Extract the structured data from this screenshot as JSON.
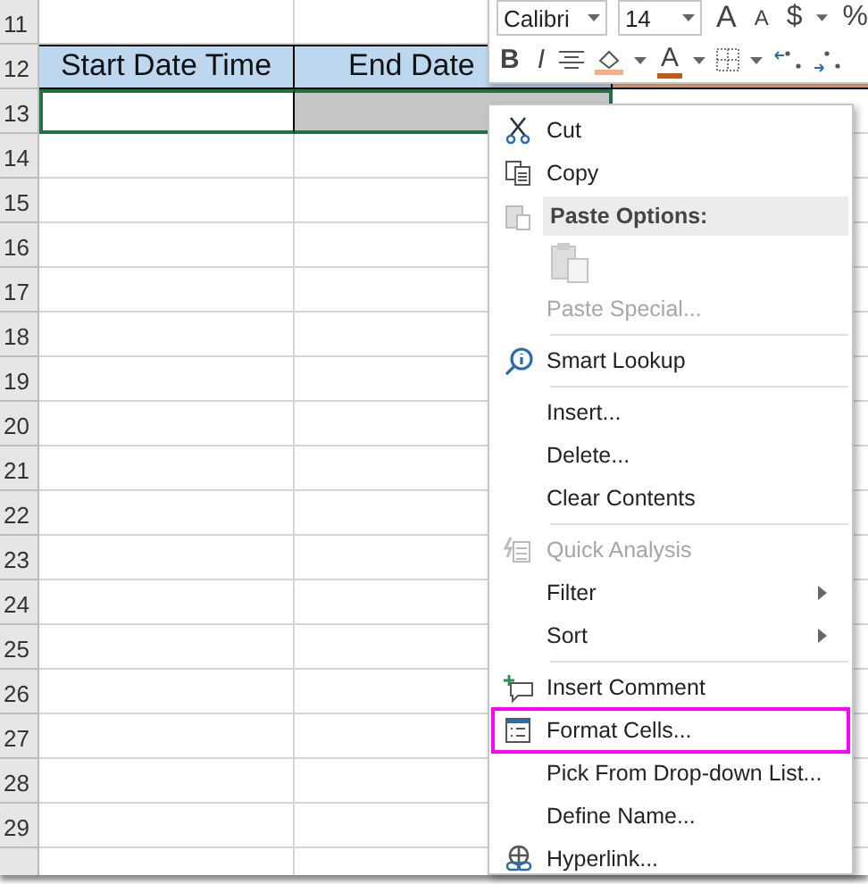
{
  "sheet": {
    "rows": [
      {
        "number": "11"
      },
      {
        "number": "12",
        "cells": [
          {
            "text": "Start Date Time",
            "color": "#bdd7ee"
          },
          {
            "text": "End Date",
            "color": "#bdd7ee"
          },
          {
            "color": "#f4b084"
          }
        ]
      },
      {
        "number": "13",
        "selected": true
      },
      {
        "number": "14"
      },
      {
        "number": "15"
      },
      {
        "number": "16"
      },
      {
        "number": "17"
      },
      {
        "number": "18"
      },
      {
        "number": "19"
      },
      {
        "number": "20"
      },
      {
        "number": "21"
      },
      {
        "number": "22"
      },
      {
        "number": "23"
      },
      {
        "number": "24"
      },
      {
        "number": "25"
      },
      {
        "number": "26"
      },
      {
        "number": "27"
      },
      {
        "number": "28"
      },
      {
        "number": "29"
      },
      {}
    ]
  },
  "mini_toolbar": {
    "font": "Calibri",
    "size": "14",
    "grow": "A",
    "shrink": "A",
    "currency": "$",
    "percent": "%",
    "bold": "B",
    "italic": "I",
    "font_color": "A"
  },
  "context_menu": [
    {
      "kind": "item",
      "label": "Cut",
      "disabled": false,
      "submenu": false,
      "highlighted": false
    },
    {
      "kind": "item",
      "label": "Copy",
      "disabled": false,
      "submenu": false,
      "highlighted": false
    },
    {
      "kind": "header",
      "label": "Paste Options:"
    },
    {
      "kind": "paste-icons"
    },
    {
      "kind": "item",
      "label": "Paste Special...",
      "disabled": true,
      "submenu": false,
      "highlighted": false
    },
    {
      "kind": "separator"
    },
    {
      "kind": "item",
      "label": "Smart Lookup",
      "disabled": false,
      "submenu": false,
      "highlighted": false
    },
    {
      "kind": "separator"
    },
    {
      "kind": "item",
      "label": "Insert...",
      "disabled": false,
      "submenu": false,
      "highlighted": false
    },
    {
      "kind": "item",
      "label": "Delete...",
      "disabled": false,
      "submenu": false,
      "highlighted": false
    },
    {
      "kind": "item",
      "label": "Clear Contents",
      "disabled": false,
      "submenu": false,
      "highlighted": false
    },
    {
      "kind": "separator"
    },
    {
      "kind": "item",
      "label": "Quick Analysis",
      "disabled": true,
      "submenu": false,
      "highlighted": false
    },
    {
      "kind": "item",
      "label": "Filter",
      "disabled": false,
      "submenu": true,
      "highlighted": false
    },
    {
      "kind": "item",
      "label": "Sort",
      "disabled": false,
      "submenu": true,
      "highlighted": false
    },
    {
      "kind": "separator"
    },
    {
      "kind": "item",
      "label": "Insert Comment",
      "disabled": false,
      "submenu": false,
      "highlighted": false
    },
    {
      "kind": "item",
      "label": "Format Cells...",
      "disabled": false,
      "submenu": false,
      "highlighted": true
    },
    {
      "kind": "item",
      "label": "Pick From Drop-down List...",
      "disabled": false,
      "submenu": false,
      "highlighted": false
    },
    {
      "kind": "item",
      "label": "Define Name...",
      "disabled": false,
      "submenu": false,
      "highlighted": false
    },
    {
      "kind": "item",
      "label": "Hyperlink...",
      "disabled": false,
      "submenu": false,
      "highlighted": false
    }
  ]
}
